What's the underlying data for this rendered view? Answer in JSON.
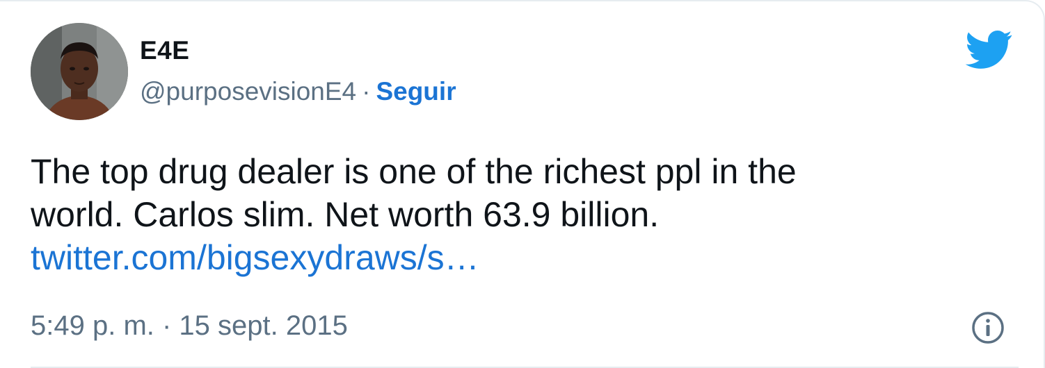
{
  "tweet": {
    "author": {
      "display_name": "E4E",
      "handle": "@purposevisionE4",
      "separator": "·",
      "follow_label": "Seguir"
    },
    "text_lines": [
      "The top drug dealer is one of the richest ppl in the",
      "world. Carlos slim. Net worth 63.9 billion."
    ],
    "link_text": "twitter.com/bigsexydraws/s…",
    "timestamp": "5:49 p. m. · 15 sept. 2015"
  },
  "icons": {
    "brand": "twitter-bird-icon",
    "info": "info-icon"
  },
  "colors": {
    "accent": "#1b74d4",
    "brand": "#1da1f2",
    "secondary_text": "#5b7083",
    "primary_text": "#0f1419",
    "divider": "#e6ecf0"
  }
}
